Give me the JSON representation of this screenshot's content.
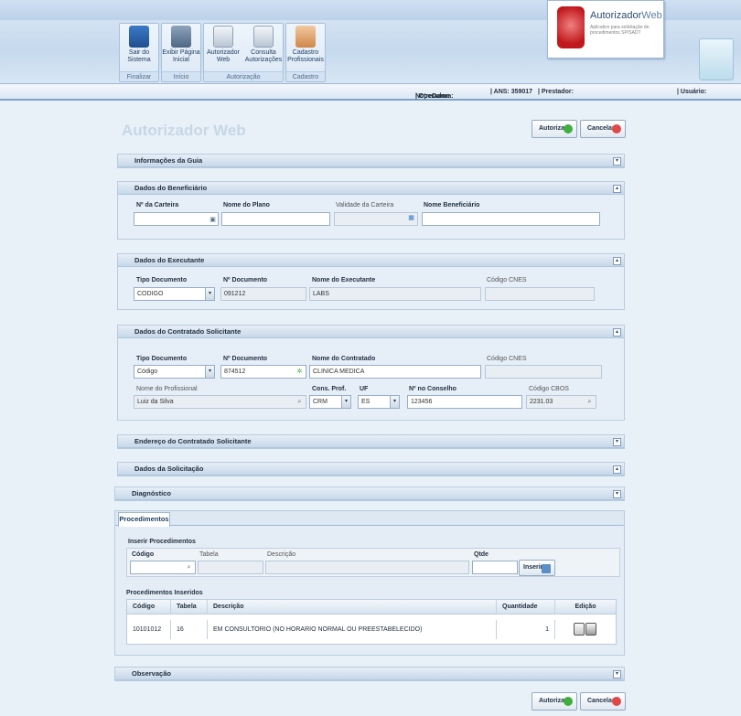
{
  "ribbon": {
    "groups": [
      {
        "label": "Finalizar",
        "buttons": [
          {
            "label": "Sair do Sistema",
            "icon": "exit-icon"
          }
        ]
      },
      {
        "label": "Início",
        "buttons": [
          {
            "label": "Exibir Página Inicial",
            "icon": "home-icon"
          }
        ]
      },
      {
        "label": "Autorização",
        "buttons": [
          {
            "label": "Autorizador Web",
            "icon": "authorize-icon"
          },
          {
            "label": "Consulta Autorizações",
            "icon": "search-doc-icon"
          }
        ]
      },
      {
        "label": "Cadastro",
        "buttons": [
          {
            "label": "Cadastro Profissionais",
            "icon": "user-icon"
          }
        ]
      }
    ]
  },
  "brand": {
    "name_a": "Autorizador",
    "name_b": "Web",
    "subtitle": "Aplicativo para solicitação de procedimentos SP/SADT"
  },
  "infobar": {
    "operadora_label": "| Operadora:",
    "operadora_value": "NotreDame",
    "ans_label": "| ANS: 359017",
    "prestador_label": "| Prestador:",
    "usuario_label": "| Usuário:"
  },
  "page": {
    "title": "Autorizador Web",
    "autorizar": "Autorizar",
    "cancelar": "Cancelar"
  },
  "sections": {
    "info_guia": "Informações da Guia",
    "beneficiario": {
      "title": "Dados do Beneficiário",
      "carteira_label": "Nº da Carteira",
      "plano_label": "Nome do Plano",
      "validade_label": "Validade da Carteira",
      "nome_label": "Nome Beneficiário",
      "carteira": "",
      "plano": "",
      "validade": "",
      "nome": ""
    },
    "executante": {
      "title": "Dados do Executante",
      "tipo_label": "Tipo Documento",
      "doc_label": "Nº Documento",
      "nome_label": "Nome do Executante",
      "cnes_label": "Código CNES",
      "tipo": "CODIGO",
      "doc": "091212",
      "nome": "LABS",
      "cnes": ""
    },
    "contratado": {
      "title": "Dados do Contratado Solicitante",
      "tipo_label": "Tipo Documento",
      "doc_label": "Nº Documento",
      "nome_label": "Nome do Contratado",
      "cnes_label": "Código CNES",
      "tipo": "Código",
      "doc": "874512",
      "nome": "CLINICA MEDICA",
      "cnes": "",
      "prof_label": "Nome do Profissional",
      "cons_label": "Cons. Prof.",
      "uf_label": "UF",
      "conselho_label": "Nº no Conselho",
      "cbos_label": "Código CBOS",
      "prof": "Luiz da Silva",
      "cons": "CRM",
      "uf": "ES",
      "conselho": "123456",
      "cbos": "2231.03"
    },
    "endereco": "Endereço do Contratado Solicitante",
    "solicitacao": "Dados da Solicitação",
    "diagnostico": "Diagnóstico",
    "observacao": "Observação"
  },
  "procedimentos": {
    "tab": "Procedimentos",
    "inserir_title": "Inserir Procedimentos",
    "codigo_label": "Código",
    "tabela_label": "Tabela",
    "descricao_label": "Descrição",
    "qtde_label": "Qtde",
    "inserir_button": "Inserir",
    "inseridos_title": "Procedimentos Inseridos",
    "columns": [
      "Código",
      "Tabela",
      "Descrição",
      "Quantidade",
      "Edição"
    ],
    "rows": [
      {
        "codigo": "10101012",
        "tabela": "16",
        "descricao": "EM CONSULTORIO (NO HORARIO NORMAL OU PREESTABELECIDO)",
        "quantidade": "1"
      }
    ]
  }
}
